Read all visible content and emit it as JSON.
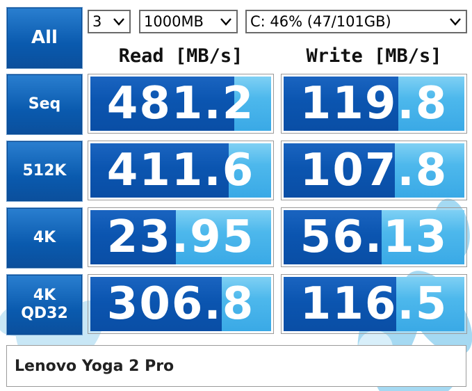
{
  "controls": {
    "all_label": "All",
    "count_value": "3",
    "size_value": "1000MB",
    "drive_value": "C: 46% (47/101GB)"
  },
  "headers": {
    "read": "Read [MB/s]",
    "write": "Write [MB/s]"
  },
  "rows": [
    {
      "label": "Seq",
      "read": "481.2",
      "write": "119.8",
      "read_fill": 0.79,
      "write_fill": 0.63
    },
    {
      "label": "512K",
      "read": "411.6",
      "write": "107.8",
      "read_fill": 0.76,
      "write_fill": 0.61
    },
    {
      "label": "4K",
      "read": "23.95",
      "write": "56.13",
      "read_fill": 0.47,
      "write_fill": 0.54
    },
    {
      "label": "4K\nQD32",
      "read": "306.8",
      "write": "116.5",
      "read_fill": 0.72,
      "write_fill": 0.62
    }
  ],
  "comment": "Lenovo Yoga 2 Pro",
  "colors": {
    "button_blue": "#0a5aae",
    "bar_dark": "#0b55b0",
    "bar_light": "#4db8ec"
  }
}
